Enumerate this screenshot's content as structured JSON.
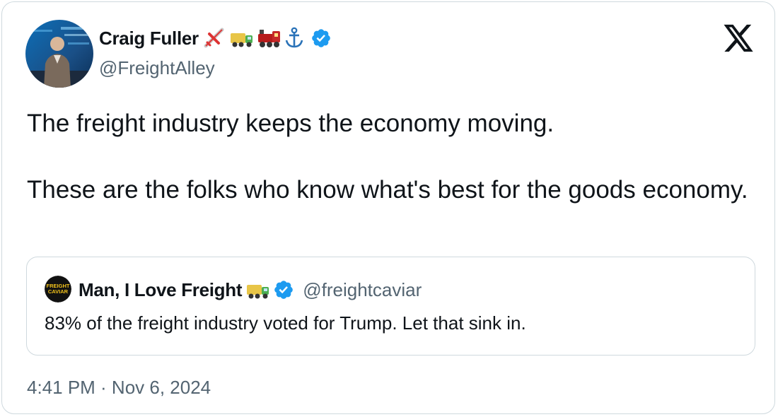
{
  "author": {
    "display_name": "Craig Fuller",
    "handle": "@FreightAlley",
    "name_emojis": [
      "airplane-icon",
      "truck-icon",
      "train-icon",
      "anchor-icon"
    ],
    "verified": true
  },
  "tweet": {
    "paragraphs": [
      "The freight industry keeps the economy moving.",
      "These are the folks who know what's best for the goods economy."
    ],
    "timestamp": "4:41 PM · Nov 6, 2024"
  },
  "quoted_tweet": {
    "display_name": "Man, I Love Freight",
    "handle": "@freightcaviar",
    "name_emojis": [
      "truck-icon"
    ],
    "verified": true,
    "avatar_text": [
      "FREIGHT",
      "CAVIAR"
    ],
    "text": "83% of the freight industry voted for Trump. Let that sink in."
  },
  "colors": {
    "text_primary": "#0f1419",
    "text_secondary": "#536471",
    "verified_blue": "#1d9bf0",
    "border": "#cfd9de"
  },
  "brand": {
    "logo": "x-logo-icon"
  }
}
